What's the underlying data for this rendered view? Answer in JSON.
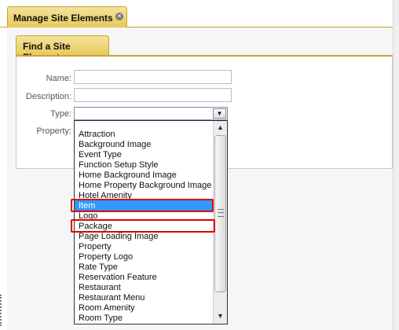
{
  "window": {
    "tab_title": "Manage Site Elements"
  },
  "find_panel": {
    "tab_title": "Find a Site Element",
    "fields": {
      "name_label": "Name:",
      "name_value": "",
      "description_label": "Description:",
      "description_value": "",
      "type_label": "Type:",
      "type_value": "",
      "property_label": "Property:"
    }
  },
  "type_dropdown": {
    "selected_option": "Item",
    "options": [
      "Attraction",
      "Background Image",
      "Event Type",
      "Function Setup Style",
      "Home Background Image",
      "Home Property Background Image",
      "Hotel Amenity",
      "Item",
      "Logo",
      "Package",
      "Page Loading Image",
      "Property",
      "Property Logo",
      "Rate Type",
      "Reservation Feature",
      "Restaurant",
      "Restaurant Menu",
      "Room Amenity",
      "Room Type"
    ],
    "annotated_options": [
      "Item",
      "Package"
    ]
  },
  "colors": {
    "tab_gold": "#e7c95a",
    "tab_border": "#c9a437",
    "selection_blue": "#3399ff",
    "annotation_red": "#e00000"
  },
  "icons": {
    "tab_close": "close-icon",
    "dropdown_arrow": "triangle-down-icon",
    "scroll_up": "triangle-up-icon",
    "scroll_down": "triangle-down-icon"
  }
}
